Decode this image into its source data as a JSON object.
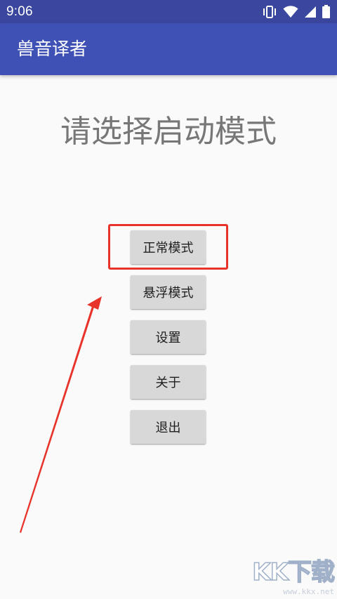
{
  "status_bar": {
    "time": "9:06",
    "icons": [
      "vibrate-icon",
      "wifi-icon",
      "signal-icon",
      "battery-icon"
    ]
  },
  "app_bar": {
    "title": "兽音译者"
  },
  "main": {
    "heading": "请选择启动模式",
    "buttons": {
      "normal_mode": "正常模式",
      "float_mode": "悬浮模式",
      "settings": "设置",
      "about": "关于",
      "exit": "退出"
    }
  },
  "annotation": {
    "highlight_color": "#e8332a"
  },
  "watermark": {
    "logo": "KK下载",
    "url": "www.kkx.net"
  },
  "colors": {
    "status_bar": "#3b479f",
    "app_bar": "#3f51b5",
    "background": "#fafafa",
    "button": "#d8d8d8"
  }
}
